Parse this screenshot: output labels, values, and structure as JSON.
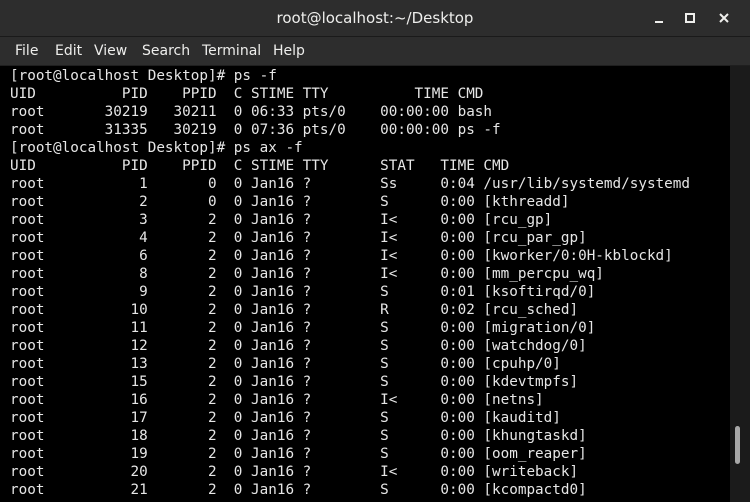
{
  "window": {
    "title": "root@localhost:~/Desktop"
  },
  "window_controls": [
    "minimize",
    "maximize",
    "close"
  ],
  "menu": {
    "file": "File",
    "edit": "Edit",
    "view": "View",
    "search": "Search",
    "terminal": "Terminal",
    "help": "Help"
  },
  "terminal": {
    "lines": [
      "[root@localhost Desktop]# ps -f",
      "UID          PID    PPID  C STIME TTY          TIME CMD",
      "root       30219   30211  0 06:33 pts/0    00:00:00 bash",
      "root       31335   30219  0 07:36 pts/0    00:00:00 ps -f",
      "[root@localhost Desktop]# ps ax -f",
      "UID          PID    PPID  C STIME TTY      STAT   TIME CMD",
      "root           1       0  0 Jan16 ?        Ss     0:04 /usr/lib/systemd/systemd",
      "root           2       0  0 Jan16 ?        S      0:00 [kthreadd]",
      "root           3       2  0 Jan16 ?        I<     0:00 [rcu_gp]",
      "root           4       2  0 Jan16 ?        I<     0:00 [rcu_par_gp]",
      "root           6       2  0 Jan16 ?        I<     0:00 [kworker/0:0H-kblockd]",
      "root           8       2  0 Jan16 ?        I<     0:00 [mm_percpu_wq]",
      "root           9       2  0 Jan16 ?        S      0:01 [ksoftirqd/0]",
      "root          10       2  0 Jan16 ?        R      0:02 [rcu_sched]",
      "root          11       2  0 Jan16 ?        S      0:00 [migration/0]",
      "root          12       2  0 Jan16 ?        S      0:00 [watchdog/0]",
      "root          13       2  0 Jan16 ?        S      0:00 [cpuhp/0]",
      "root          15       2  0 Jan16 ?        S      0:00 [kdevtmpfs]",
      "root          16       2  0 Jan16 ?        I<     0:00 [netns]",
      "root          17       2  0 Jan16 ?        S      0:00 [kauditd]",
      "root          18       2  0 Jan16 ?        S      0:00 [khungtaskd]",
      "root          19       2  0 Jan16 ?        S      0:00 [oom_reaper]",
      "root          20       2  0 Jan16 ?        I<     0:00 [writeback]",
      "root          21       2  0 Jan16 ?        S      0:00 [kcompactd0]"
    ]
  },
  "colors": {
    "titlebar": "#2d2d2d",
    "terminal_bg": "#000000",
    "terminal_fg": "#e6e6e6",
    "scroll_thumb": "#a8a8a8"
  }
}
